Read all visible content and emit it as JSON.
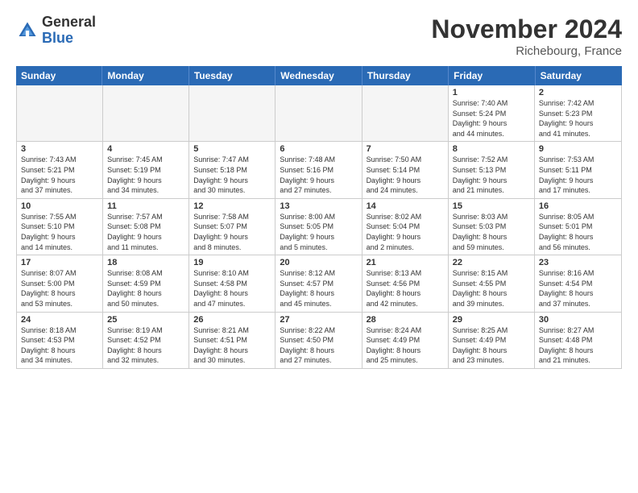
{
  "header": {
    "logo_general": "General",
    "logo_blue": "Blue",
    "month_title": "November 2024",
    "location": "Richebourg, France"
  },
  "days_of_week": [
    "Sunday",
    "Monday",
    "Tuesday",
    "Wednesday",
    "Thursday",
    "Friday",
    "Saturday"
  ],
  "weeks": [
    [
      {
        "day": "",
        "info": "",
        "empty": true
      },
      {
        "day": "",
        "info": "",
        "empty": true
      },
      {
        "day": "",
        "info": "",
        "empty": true
      },
      {
        "day": "",
        "info": "",
        "empty": true
      },
      {
        "day": "",
        "info": "",
        "empty": true
      },
      {
        "day": "1",
        "info": "Sunrise: 7:40 AM\nSunset: 5:24 PM\nDaylight: 9 hours\nand 44 minutes."
      },
      {
        "day": "2",
        "info": "Sunrise: 7:42 AM\nSunset: 5:23 PM\nDaylight: 9 hours\nand 41 minutes."
      }
    ],
    [
      {
        "day": "3",
        "info": "Sunrise: 7:43 AM\nSunset: 5:21 PM\nDaylight: 9 hours\nand 37 minutes."
      },
      {
        "day": "4",
        "info": "Sunrise: 7:45 AM\nSunset: 5:19 PM\nDaylight: 9 hours\nand 34 minutes."
      },
      {
        "day": "5",
        "info": "Sunrise: 7:47 AM\nSunset: 5:18 PM\nDaylight: 9 hours\nand 30 minutes."
      },
      {
        "day": "6",
        "info": "Sunrise: 7:48 AM\nSunset: 5:16 PM\nDaylight: 9 hours\nand 27 minutes."
      },
      {
        "day": "7",
        "info": "Sunrise: 7:50 AM\nSunset: 5:14 PM\nDaylight: 9 hours\nand 24 minutes."
      },
      {
        "day": "8",
        "info": "Sunrise: 7:52 AM\nSunset: 5:13 PM\nDaylight: 9 hours\nand 21 minutes."
      },
      {
        "day": "9",
        "info": "Sunrise: 7:53 AM\nSunset: 5:11 PM\nDaylight: 9 hours\nand 17 minutes."
      }
    ],
    [
      {
        "day": "10",
        "info": "Sunrise: 7:55 AM\nSunset: 5:10 PM\nDaylight: 9 hours\nand 14 minutes."
      },
      {
        "day": "11",
        "info": "Sunrise: 7:57 AM\nSunset: 5:08 PM\nDaylight: 9 hours\nand 11 minutes."
      },
      {
        "day": "12",
        "info": "Sunrise: 7:58 AM\nSunset: 5:07 PM\nDaylight: 9 hours\nand 8 minutes."
      },
      {
        "day": "13",
        "info": "Sunrise: 8:00 AM\nSunset: 5:05 PM\nDaylight: 9 hours\nand 5 minutes."
      },
      {
        "day": "14",
        "info": "Sunrise: 8:02 AM\nSunset: 5:04 PM\nDaylight: 9 hours\nand 2 minutes."
      },
      {
        "day": "15",
        "info": "Sunrise: 8:03 AM\nSunset: 5:03 PM\nDaylight: 8 hours\nand 59 minutes."
      },
      {
        "day": "16",
        "info": "Sunrise: 8:05 AM\nSunset: 5:01 PM\nDaylight: 8 hours\nand 56 minutes."
      }
    ],
    [
      {
        "day": "17",
        "info": "Sunrise: 8:07 AM\nSunset: 5:00 PM\nDaylight: 8 hours\nand 53 minutes."
      },
      {
        "day": "18",
        "info": "Sunrise: 8:08 AM\nSunset: 4:59 PM\nDaylight: 8 hours\nand 50 minutes."
      },
      {
        "day": "19",
        "info": "Sunrise: 8:10 AM\nSunset: 4:58 PM\nDaylight: 8 hours\nand 47 minutes."
      },
      {
        "day": "20",
        "info": "Sunrise: 8:12 AM\nSunset: 4:57 PM\nDaylight: 8 hours\nand 45 minutes."
      },
      {
        "day": "21",
        "info": "Sunrise: 8:13 AM\nSunset: 4:56 PM\nDaylight: 8 hours\nand 42 minutes."
      },
      {
        "day": "22",
        "info": "Sunrise: 8:15 AM\nSunset: 4:55 PM\nDaylight: 8 hours\nand 39 minutes."
      },
      {
        "day": "23",
        "info": "Sunrise: 8:16 AM\nSunset: 4:54 PM\nDaylight: 8 hours\nand 37 minutes."
      }
    ],
    [
      {
        "day": "24",
        "info": "Sunrise: 8:18 AM\nSunset: 4:53 PM\nDaylight: 8 hours\nand 34 minutes."
      },
      {
        "day": "25",
        "info": "Sunrise: 8:19 AM\nSunset: 4:52 PM\nDaylight: 8 hours\nand 32 minutes."
      },
      {
        "day": "26",
        "info": "Sunrise: 8:21 AM\nSunset: 4:51 PM\nDaylight: 8 hours\nand 30 minutes."
      },
      {
        "day": "27",
        "info": "Sunrise: 8:22 AM\nSunset: 4:50 PM\nDaylight: 8 hours\nand 27 minutes."
      },
      {
        "day": "28",
        "info": "Sunrise: 8:24 AM\nSunset: 4:49 PM\nDaylight: 8 hours\nand 25 minutes."
      },
      {
        "day": "29",
        "info": "Sunrise: 8:25 AM\nSunset: 4:49 PM\nDaylight: 8 hours\nand 23 minutes."
      },
      {
        "day": "30",
        "info": "Sunrise: 8:27 AM\nSunset: 4:48 PM\nDaylight: 8 hours\nand 21 minutes."
      }
    ]
  ]
}
